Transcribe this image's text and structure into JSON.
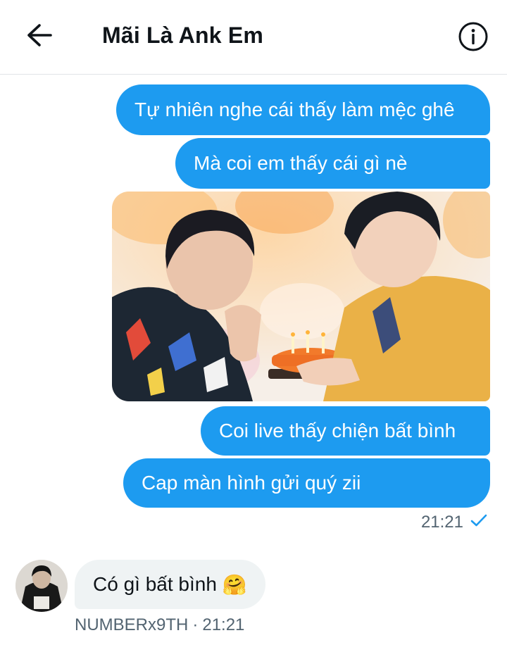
{
  "header": {
    "title": "Mãi Là Ank Em",
    "back_icon": "arrow-left-icon",
    "info_icon": "info-circle-icon"
  },
  "messages_out": [
    {
      "text": "Tự nhiên nghe cái thấy làm mệc ghê"
    },
    {
      "text": "Mà coi em thấy cái gì nè"
    },
    {
      "text": "Coi live thấy chiện bất bình"
    },
    {
      "text": "Cap màn hình gửi quý zii"
    }
  ],
  "sent_meta": {
    "time": "21:21",
    "status_icon": "check-icon"
  },
  "message_in": {
    "text": "Có gì bất bình",
    "emoji": "🤗"
  },
  "received_meta": {
    "sender": "NUMBERx9TH",
    "separator": "·",
    "time": "21:21"
  },
  "colors": {
    "accent": "#1d9bf0",
    "incoming_bubble": "#eff3f4",
    "meta_text": "#536471"
  }
}
